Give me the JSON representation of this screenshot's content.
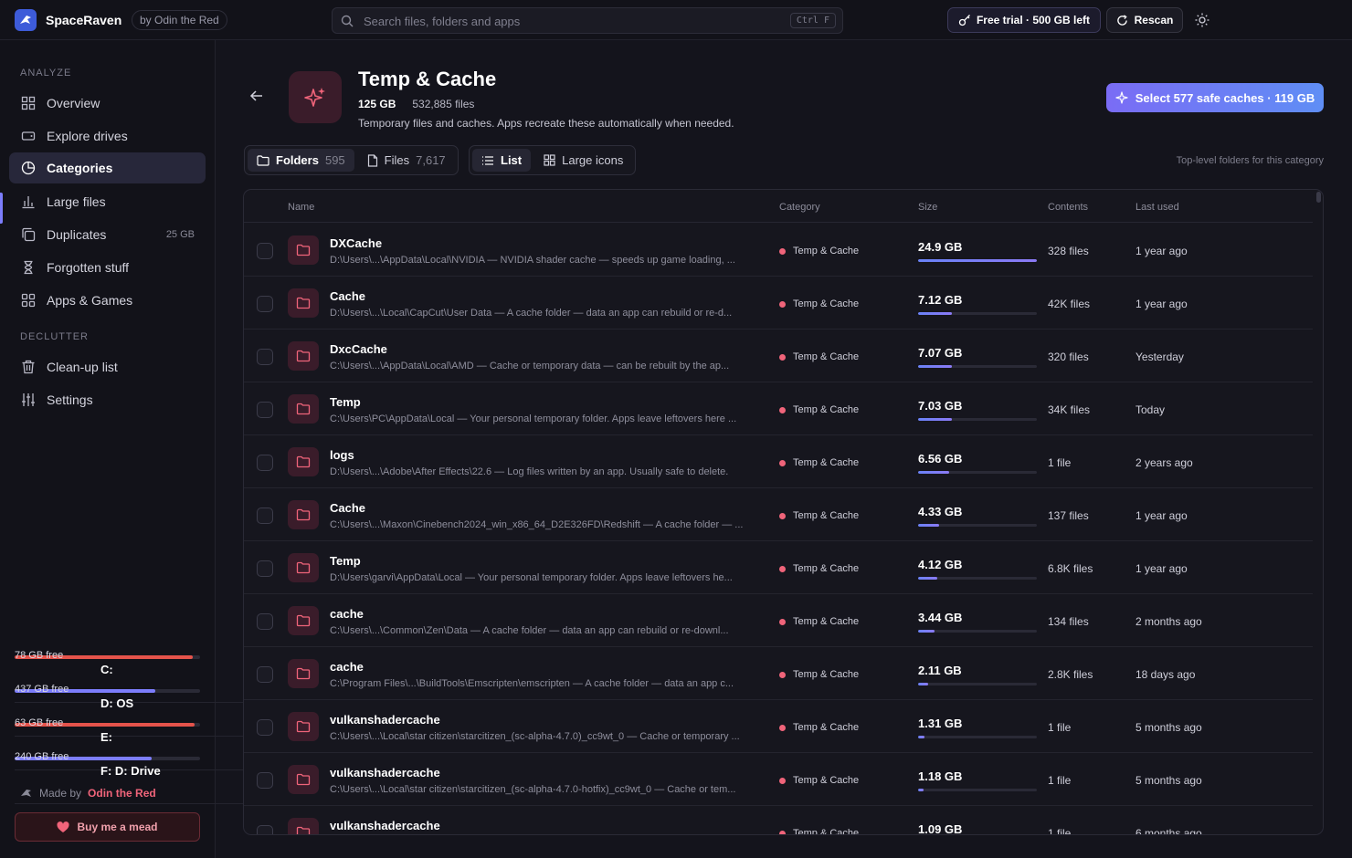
{
  "app": {
    "name": "SpaceRaven",
    "by": "by Odin the Red",
    "search_placeholder": "Search files, folders and apps",
    "search_shortcut": "Ctrl F",
    "trial_label": "Free trial · 500 GB left",
    "rescan_label": "Rescan"
  },
  "sidebar": {
    "analyze_label": "ANALYZE",
    "declutter_label": "DECLUTTER",
    "items": [
      {
        "label": "Overview",
        "icon": "grid-icon"
      },
      {
        "label": "Explore drives",
        "icon": "drive-icon"
      },
      {
        "label": "Categories",
        "icon": "pie-icon",
        "active": true
      },
      {
        "label": "Large files",
        "icon": "bar-chart-icon"
      },
      {
        "label": "Duplicates",
        "icon": "copy-icon",
        "badge": "25 GB"
      },
      {
        "label": "Forgotten stuff",
        "icon": "hourglass-icon"
      },
      {
        "label": "Apps & Games",
        "icon": "apps-icon"
      },
      {
        "label": "Clean-up list",
        "icon": "trash-icon"
      },
      {
        "label": "Settings",
        "icon": "sliders-icon"
      }
    ],
    "drives": [
      {
        "name": "C:",
        "free": "78 GB free",
        "used_fraction": 0.96,
        "color": "#e5534b"
      },
      {
        "name": "D: OS",
        "free": "437 GB free",
        "used_fraction": 0.76,
        "color": "#7c7dfc"
      },
      {
        "name": "E:",
        "free": "63 GB free",
        "used_fraction": 0.97,
        "color": "#e5534b"
      },
      {
        "name": "F: D: Drive",
        "free": "240 GB free",
        "used_fraction": 0.74,
        "color": "#7c7dfc"
      }
    ],
    "made_by_label": "Made by",
    "made_by_name": "Odin the Red",
    "mead_label": "Buy me a mead"
  },
  "header": {
    "title": "Temp & Cache",
    "size": "125 GB",
    "files": "532,885 files",
    "description": "Temporary files and caches. Apps recreate these automatically when needed.",
    "select_label": "Select 577 safe caches · 119 GB",
    "tabs": [
      {
        "label": "Folders",
        "count": "595"
      },
      {
        "label": "Files",
        "count": "7,617"
      }
    ],
    "views": [
      {
        "label": "List"
      },
      {
        "label": "Large icons"
      }
    ],
    "hint": "Top-level folders for this category"
  },
  "table": {
    "columns": [
      "Name",
      "Category",
      "Size",
      "Contents",
      "Last used"
    ],
    "rows": [
      {
        "name": "DXCache",
        "path": "D:\\Users\\...\\AppData\\Local\\NVIDIA — NVIDIA shader cache — speeds up game loading, ...",
        "category": "Temp & Cache",
        "size": "24.9 GB",
        "size_fraction": 1.0,
        "contents": "328 files",
        "last_used": "1 year ago"
      },
      {
        "name": "Cache",
        "path": "D:\\Users\\...\\Local\\CapCut\\User Data — A cache folder — data an app can rebuild or re-d...",
        "category": "Temp & Cache",
        "size": "7.12 GB",
        "size_fraction": 0.286,
        "contents": "42K files",
        "last_used": "1 year ago"
      },
      {
        "name": "DxcCache",
        "path": "C:\\Users\\...\\AppData\\Local\\AMD — Cache or temporary data — can be rebuilt by the ap...",
        "category": "Temp & Cache",
        "size": "7.07 GB",
        "size_fraction": 0.284,
        "contents": "320 files",
        "last_used": "Yesterday"
      },
      {
        "name": "Temp",
        "path": "C:\\Users\\PC\\AppData\\Local — Your personal temporary folder. Apps leave leftovers here ...",
        "category": "Temp & Cache",
        "size": "7.03 GB",
        "size_fraction": 0.282,
        "contents": "34K files",
        "last_used": "Today"
      },
      {
        "name": "logs",
        "path": "D:\\Users\\...\\Adobe\\After Effects\\22.6 — Log files written by an app. Usually safe to delete.",
        "category": "Temp & Cache",
        "size": "6.56 GB",
        "size_fraction": 0.263,
        "contents": "1 file",
        "last_used": "2 years ago"
      },
      {
        "name": "Cache",
        "path": "C:\\Users\\...\\Maxon\\Cinebench2024_win_x86_64_D2E326FD\\Redshift — A cache folder — ...",
        "category": "Temp & Cache",
        "size": "4.33 GB",
        "size_fraction": 0.174,
        "contents": "137 files",
        "last_used": "1 year ago"
      },
      {
        "name": "Temp",
        "path": "D:\\Users\\garvi\\AppData\\Local — Your personal temporary folder. Apps leave leftovers he...",
        "category": "Temp & Cache",
        "size": "4.12 GB",
        "size_fraction": 0.165,
        "contents": "6.8K files",
        "last_used": "1 year ago"
      },
      {
        "name": "cache",
        "path": "C:\\Users\\...\\Common\\Zen\\Data — A cache folder — data an app can rebuild or re-downl...",
        "category": "Temp & Cache",
        "size": "3.44 GB",
        "size_fraction": 0.138,
        "contents": "134 files",
        "last_used": "2 months ago"
      },
      {
        "name": "cache",
        "path": "C:\\Program Files\\...\\BuildTools\\Emscripten\\emscripten — A cache folder — data an app c...",
        "category": "Temp & Cache",
        "size": "2.11 GB",
        "size_fraction": 0.085,
        "contents": "2.8K files",
        "last_used": "18 days ago"
      },
      {
        "name": "vulkanshadercache",
        "path": "C:\\Users\\...\\Local\\star citizen\\starcitizen_(sc-alpha-4.7.0)_cc9wt_0 — Cache or temporary ...",
        "category": "Temp & Cache",
        "size": "1.31 GB",
        "size_fraction": 0.053,
        "contents": "1 file",
        "last_used": "5 months ago"
      },
      {
        "name": "vulkanshadercache",
        "path": "C:\\Users\\...\\Local\\star citizen\\starcitizen_(sc-alpha-4.7.0-hotfix)_cc9wt_0 — Cache or tem...",
        "category": "Temp & Cache",
        "size": "1.18 GB",
        "size_fraction": 0.047,
        "contents": "1 file",
        "last_used": "5 months ago"
      },
      {
        "name": "vulkanshadercache",
        "path": "",
        "category": "Temp & Cache",
        "size": "1.09 GB",
        "size_fraction": 0.044,
        "contents": "1 file",
        "last_used": "6 months ago"
      }
    ]
  }
}
